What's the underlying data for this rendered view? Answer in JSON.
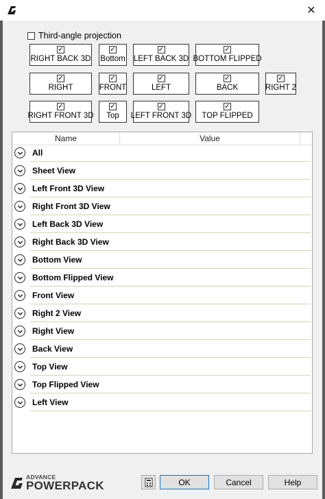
{
  "checkbox": {
    "third_angle_label": "Third-angle projection",
    "third_angle_checked": false
  },
  "view_buttons": [
    {
      "label": "RIGHT BACK 3D",
      "checked": true
    },
    {
      "label": "Bottom",
      "checked": true
    },
    {
      "label": "LEFT BACK 3D",
      "checked": true
    },
    {
      "label": "BOTTOM FLIPPED",
      "checked": true
    },
    {
      "label": "RIGHT",
      "checked": true
    },
    {
      "label": "FRONT",
      "checked": true
    },
    {
      "label": "LEFT",
      "checked": true
    },
    {
      "label": "BACK",
      "checked": true
    },
    {
      "label": "RIGHT 2",
      "checked": true
    },
    {
      "label": "RIGHT FRONT 3D",
      "checked": true
    },
    {
      "label": "Top",
      "checked": true
    },
    {
      "label": "LEFT FRONT 3D",
      "checked": true
    },
    {
      "label": "TOP FLIPPED",
      "checked": true
    }
  ],
  "grid": {
    "col_name": "Name",
    "col_value": "Value",
    "rows": [
      "All",
      "Sheet View",
      "Left Front 3D View",
      "Right Front 3D View",
      "Left Back 3D View",
      "Right Back 3D View",
      "Bottom View",
      "Bottom Flipped View",
      "Front View",
      "Right 2 View",
      "Right View",
      "Back View",
      "Top View",
      "Top Flipped View",
      "Left View"
    ]
  },
  "footer": {
    "logo_top": "ADVANCE",
    "logo_main": "POWERPACK",
    "ok": "OK",
    "cancel": "Cancel",
    "help": "Help"
  },
  "colors": {
    "accent": "#0078d7",
    "row_underline": "#cfd8b0"
  }
}
